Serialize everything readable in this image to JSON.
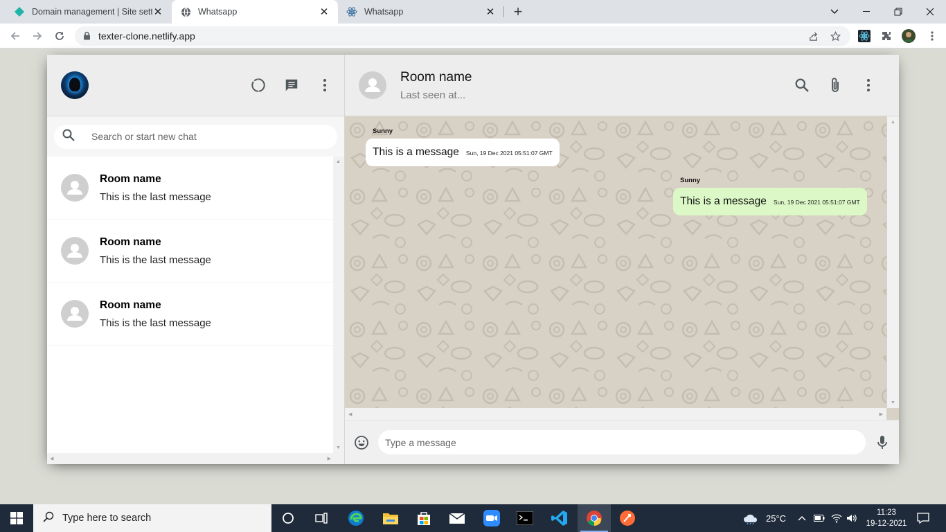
{
  "browser": {
    "tabs": [
      {
        "title": "Domain management | Site settin",
        "active": false,
        "favicon": "netlify-diamond-icon"
      },
      {
        "title": "Whatsapp",
        "active": true,
        "favicon": "globe-icon"
      },
      {
        "title": "Whatsapp",
        "active": false,
        "favicon": "react-icon"
      }
    ],
    "url": "texter-clone.netlify.app"
  },
  "sidebar": {
    "search_placeholder": "Search or start new chat",
    "chats": [
      {
        "name": "Room name",
        "last_message": "This is the last message"
      },
      {
        "name": "Room name",
        "last_message": "This is the last message"
      },
      {
        "name": "Room name",
        "last_message": "This is the last message"
      }
    ]
  },
  "chat": {
    "header": {
      "room_name": "Room name",
      "last_seen": "Last seen at..."
    },
    "messages": [
      {
        "name": "Sunny",
        "text": "This is a message",
        "timestamp": "Sun, 19 Dec 2021 05:51:07 GMT",
        "receiver": false
      },
      {
        "name": "Sunny",
        "text": "This is a message",
        "timestamp": "Sun, 19 Dec 2021 05:51:07 GMT",
        "receiver": true
      }
    ],
    "input_placeholder": "Type a message"
  },
  "taskbar": {
    "search_label": "Type here to search",
    "weather": "25°C",
    "time": "11:23",
    "date": "19-12-2021"
  },
  "colors": {
    "sender_bubble": "#ffffff",
    "receiver_bubble": "#dcf8c6",
    "chat_background": "#d8d1c6",
    "app_background": "#dadbd3"
  }
}
